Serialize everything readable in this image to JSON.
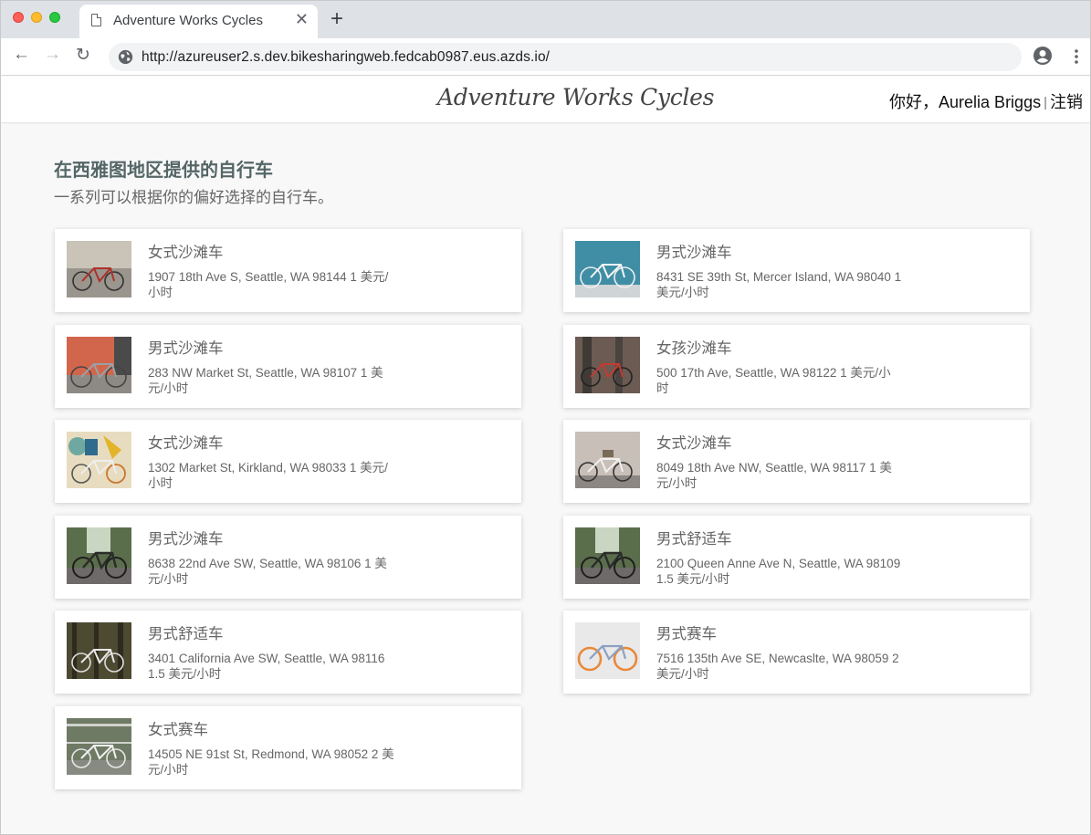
{
  "browser": {
    "tab_title": "Adventure Works Cycles",
    "url": "http://azureuser2.s.dev.bikesharingweb.fedcab0987.eus.azds.io/"
  },
  "header": {
    "logo_text": "Adventure Works Cycles",
    "greeting": "你好，Aurelia Briggs",
    "separator": "|",
    "logout": "注销"
  },
  "page": {
    "title": "在西雅图地区提供的自行车",
    "subtitle": "一系列可以根据你的偏好选择的自行车。"
  },
  "bikes": [
    {
      "name": "女式沙滩车",
      "desc": "1907 18th Ave S, Seattle, WA 98144 1 美元/小时"
    },
    {
      "name": "男式沙滩车",
      "desc": "8431 SE 39th St, Mercer Island, WA 98040 1 美元/小时"
    },
    {
      "name": "男式沙滩车",
      "desc": "283 NW Market St, Seattle, WA 98107 1 美元/小时"
    },
    {
      "name": "女孩沙滩车",
      "desc": "500 17th Ave, Seattle, WA 98122 1 美元/小时"
    },
    {
      "name": "女式沙滩车",
      "desc": "1302 Market St, Kirkland, WA 98033 1 美元/小时"
    },
    {
      "name": "女式沙滩车",
      "desc": "8049 18th Ave NW, Seattle, WA 98117 1 美元/小时"
    },
    {
      "name": "男式沙滩车",
      "desc": "8638 22nd Ave SW, Seattle, WA 98106 1 美元/小时"
    },
    {
      "name": "男式舒适车",
      "desc": "2100 Queen Anne Ave N, Seattle, WA 98109 1.5 美元/小时"
    },
    {
      "name": "男式舒适车",
      "desc": "3401 California Ave SW, Seattle, WA 98116 1.5 美元/小时"
    },
    {
      "name": "男式赛车",
      "desc": "7516 135th Ave SE, Newcaslte, WA 98059 2 美元/小时"
    },
    {
      "name": "女式赛车",
      "desc": "14505 NE 91st St, Redmond, WA 98052 2 美元/小时"
    }
  ]
}
